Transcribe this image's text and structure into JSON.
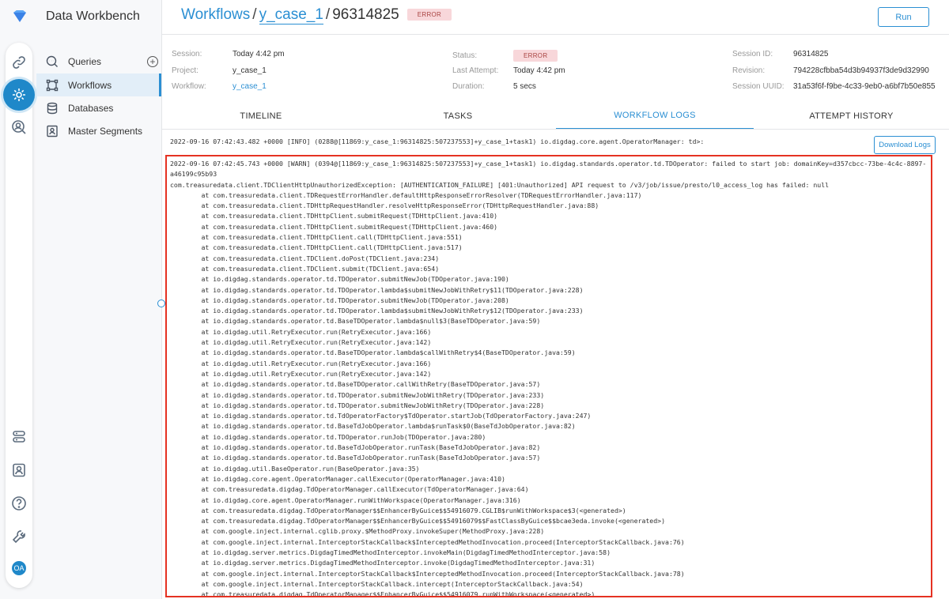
{
  "app": {
    "title": "Data Workbench"
  },
  "rail": {
    "icons": [
      "link-icon",
      "workflow-gear-icon",
      "audience-search-icon",
      "layers-icon",
      "profile-icon",
      "help-icon",
      "wrench-icon"
    ],
    "avatar_initials": "OA",
    "accent": "#1f88c9"
  },
  "nav": {
    "items": [
      {
        "label": "Queries",
        "icon": "query-icon"
      },
      {
        "label": "Workflows",
        "icon": "workflow-icon"
      },
      {
        "label": "Databases",
        "icon": "database-icon"
      },
      {
        "label": "Master Segments",
        "icon": "segment-icon"
      }
    ],
    "add_label": "+"
  },
  "breadcrumb": {
    "root": "Workflows",
    "project": "y_case_1",
    "attempt": "96314825",
    "status": "ERROR"
  },
  "header": {
    "run_label": "Run"
  },
  "session": {
    "left": [
      {
        "key": "Session:",
        "value": "Today 4:42 pm"
      },
      {
        "key": "Project:",
        "value": "y_case_1"
      },
      {
        "key": "Workflow:",
        "value": "y_case_1"
      }
    ],
    "middle": [
      {
        "key": "Status:",
        "value": "ERROR"
      },
      {
        "key": "Last Attempt:",
        "value": "Today 4:42 pm"
      },
      {
        "key": "Duration:",
        "value": "5 secs"
      }
    ],
    "right": [
      {
        "key": "Session ID:",
        "value": "96314825"
      },
      {
        "key": "Revision:",
        "value": "794228cfbba54d3b94937f3de9d32990"
      },
      {
        "key": "Session UUID:",
        "value": "31a53f6f-f9be-4c33-9eb0-a6bf7b50e855"
      }
    ]
  },
  "tabs": [
    "TIMELINE",
    "TASKS",
    "WORKFLOW LOGS",
    "ATTEMPT HISTORY"
  ],
  "logs": {
    "download_label": "Download Logs",
    "first_line": "2022-09-16 07:42:43.482 +0000 [INFO] (0288@[11869:y_case_1:96314825:507237553]+y_case_1+task1) io.digdag.core.agent.OperatorManager: td>:",
    "lines": [
      "2022-09-16 07:42:45.743 +0000 [WARN] (0394@[11869:y_case_1:96314825:507237553]+y_case_1+task1) io.digdag.standards.operator.td.TDOperator: failed to start job: domainKey=d357cbcc-73be-4c4c-8897-a46199c95b93",
      "com.treasuredata.client.TDClientHttpUnauthorizedException: [AUTHENTICATION_FAILURE] [401:Unauthorized] API request to /v3/job/issue/presto/l0_access_log has failed: null",
      "\tat com.treasuredata.client.TDRequestErrorHandler.defaultHttpResponseErrorResolver(TDRequestErrorHandler.java:117)",
      "\tat com.treasuredata.client.TDHttpRequestHandler.resolveHttpResponseError(TDHttpRequestHandler.java:88)",
      "\tat com.treasuredata.client.TDHttpClient.submitRequest(TDHttpClient.java:410)",
      "\tat com.treasuredata.client.TDHttpClient.submitRequest(TDHttpClient.java:460)",
      "\tat com.treasuredata.client.TDHttpClient.call(TDHttpClient.java:551)",
      "\tat com.treasuredata.client.TDHttpClient.call(TDHttpClient.java:517)",
      "\tat com.treasuredata.client.TDClient.doPost(TDClient.java:234)",
      "\tat com.treasuredata.client.TDClient.submit(TDClient.java:654)",
      "\tat io.digdag.standards.operator.td.TDOperator.submitNewJob(TDOperator.java:190)",
      "\tat io.digdag.standards.operator.td.TDOperator.lambda$submitNewJobWithRetry$11(TDOperator.java:228)",
      "\tat io.digdag.standards.operator.td.TDOperator.submitNewJob(TDOperator.java:208)",
      "\tat io.digdag.standards.operator.td.TDOperator.lambda$submitNewJobWithRetry$12(TDOperator.java:233)",
      "\tat io.digdag.standards.operator.td.BaseTDOperator.lambda$null$3(BaseTDOperator.java:59)",
      "\tat io.digdag.util.RetryExecutor.run(RetryExecutor.java:166)",
      "\tat io.digdag.util.RetryExecutor.run(RetryExecutor.java:142)",
      "\tat io.digdag.standards.operator.td.BaseTDOperator.lambda$callWithRetry$4(BaseTDOperator.java:59)",
      "\tat io.digdag.util.RetryExecutor.run(RetryExecutor.java:166)",
      "\tat io.digdag.util.RetryExecutor.run(RetryExecutor.java:142)",
      "\tat io.digdag.standards.operator.td.BaseTDOperator.callWithRetry(BaseTDOperator.java:57)",
      "\tat io.digdag.standards.operator.td.TDOperator.submitNewJobWithRetry(TDOperator.java:233)",
      "\tat io.digdag.standards.operator.td.TDOperator.submitNewJobWithRetry(TDOperator.java:228)",
      "\tat io.digdag.standards.operator.td.TdOperatorFactory$TdOperator.startJob(TdOperatorFactory.java:247)",
      "\tat io.digdag.standards.operator.td.BaseTdJobOperator.lambda$runTask$0(BaseTdJobOperator.java:82)",
      "\tat io.digdag.standards.operator.td.TDOperator.runJob(TDOperator.java:280)",
      "\tat io.digdag.standards.operator.td.BaseTdJobOperator.runTask(BaseTdJobOperator.java:82)",
      "\tat io.digdag.standards.operator.td.BaseTdJobOperator.runTask(BaseTdJobOperator.java:57)",
      "\tat io.digdag.util.BaseOperator.run(BaseOperator.java:35)",
      "\tat io.digdag.core.agent.OperatorManager.callExecutor(OperatorManager.java:410)",
      "\tat com.treasuredata.digdag.TdOperatorManager.callExecutor(TdOperatorManager.java:64)",
      "\tat io.digdag.core.agent.OperatorManager.runWithWorkspace(OperatorManager.java:316)",
      "\tat com.treasuredata.digdag.TdOperatorManager$$EnhancerByGuice$$54916079.CGLIB$runWithWorkspace$3(<generated>)",
      "\tat com.treasuredata.digdag.TdOperatorManager$$EnhancerByGuice$$54916079$$FastClassByGuice$$bcae3eda.invoke(<generated>)",
      "\tat com.google.inject.internal.cglib.proxy.$MethodProxy.invokeSuper(MethodProxy.java:228)",
      "\tat com.google.inject.internal.InterceptorStackCallback$InterceptedMethodInvocation.proceed(InterceptorStackCallback.java:76)",
      "\tat io.digdag.server.metrics.DigdagTimedMethodInterceptor.invokeMain(DigdagTimedMethodInterceptor.java:58)",
      "\tat io.digdag.server.metrics.DigdagTimedMethodInterceptor.invoke(DigdagTimedMethodInterceptor.java:31)",
      "\tat com.google.inject.internal.InterceptorStackCallback$InterceptedMethodInvocation.proceed(InterceptorStackCallback.java:78)",
      "\tat com.google.inject.internal.InterceptorStackCallback.intercept(InterceptorStackCallback.java:54)",
      "\tat com.treasuredata.digdag.TdOperatorManager$$EnhancerByGuice$$54916079.runWithWorkspace(<generated>)"
    ]
  }
}
